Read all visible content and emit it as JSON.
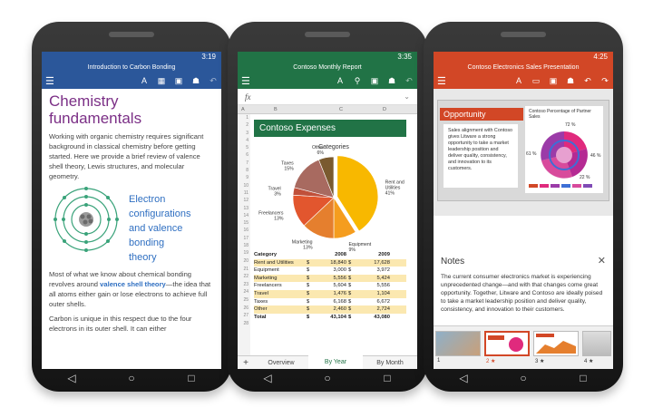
{
  "word": {
    "time": "3:19",
    "title": "Introduction to Carbon Bonding",
    "heading_line1": "Chemistry",
    "heading_line2": "fundamentals",
    "para1": "Working with organic chemistry requires significant background in classical chemistry before getting started. Here we provide a brief review of valence shell theory, Lewis structures, and molecular geometry.",
    "side_l1": "Electron",
    "side_l2": "configurations",
    "side_l3": "and valence",
    "side_l4": "bonding",
    "side_l5": "theory",
    "para2_a": "Most of what we know about chemical bonding revolves around ",
    "para2_link": "valence shell theory",
    "para2_b": "—the idea that all atoms either gain or lose electrons to achieve full outer shells.",
    "para3": "Carbon is unique in this respect due to the four electrons in its outer shell. It can either"
  },
  "excel": {
    "time": "3:35",
    "title": "Contoso Monthly Report",
    "fx": "fx",
    "col_a": "A",
    "col_b": "B",
    "col_c": "C",
    "col_d": "D",
    "banner": "Contoso Expenses",
    "chart_data": {
      "type": "pie",
      "title": "Categories",
      "slices": [
        {
          "label": "Rent and Utilities",
          "pct": "41%",
          "value": 41,
          "color": "#f8b800"
        },
        {
          "label": "Equipment",
          "pct": "9%",
          "value": 9,
          "color": "#f59d1e"
        },
        {
          "label": "Marketing",
          "pct": "13%",
          "value": 13,
          "color": "#e57f2e"
        },
        {
          "label": "Freelancers",
          "pct": "13%",
          "value": 13,
          "color": "#e2562e"
        },
        {
          "label": "Travel",
          "pct": "3%",
          "value": 3,
          "color": "#c0503a"
        },
        {
          "label": "Taxes",
          "pct": "15%",
          "value": 15,
          "color": "#a86a60"
        },
        {
          "label": "Other",
          "pct": "6%",
          "value": 6,
          "color": "#7a5a2f"
        }
      ]
    },
    "table_header": {
      "c1": "Category",
      "c2": "2008",
      "c3": "2009"
    },
    "rows": [
      {
        "n": "20",
        "cat": "Rent and Utilities",
        "v1": "18,840",
        "v2": "17,628"
      },
      {
        "n": "21",
        "cat": "Equipment",
        "v1": "3,000",
        "v2": "3,972"
      },
      {
        "n": "22",
        "cat": "Marketing",
        "v1": "5,556",
        "v2": "5,424"
      },
      {
        "n": "23",
        "cat": "Freelancers",
        "v1": "5,604",
        "v2": "5,556"
      },
      {
        "n": "24",
        "cat": "Travel",
        "v1": "1,476",
        "v2": "1,104"
      },
      {
        "n": "25",
        "cat": "Taxes",
        "v1": "6,168",
        "v2": "6,672"
      },
      {
        "n": "26",
        "cat": "Other",
        "v1": "2,460",
        "v2": "2,724"
      },
      {
        "n": "27",
        "cat": "Total",
        "v1": "43,104",
        "v2": "43,080"
      }
    ],
    "currency": "$",
    "tab_add": "+",
    "tab1": "Overview",
    "tab2": "By Year",
    "tab3": "By Month"
  },
  "ppt": {
    "time": "4:25",
    "title": "Contoso Electronics Sales Presentation",
    "opportunity": "Opportunity",
    "card_text": "Sales alignment with Contoso gives Litware a strong opportunity to take a market leadership position and deliver quality, consistency, and innovation to its customers.",
    "pie_title": "Contoso Percentage of Partner Sales",
    "pie_l1": "72 %",
    "pie_l2": "61 %",
    "pie_l3": "46 %",
    "pie_l4": "22 %",
    "notes_title": "Notes",
    "notes_text": "The current consumer electronics market is experiencing unprecedented change—and with that changes come great opportunity. Together, Litware and Contoso are ideally poised to take a market leadership position and deliver quality, consistency, and innovation to their customers.",
    "thumb1": "1",
    "thumb2": "2 ★",
    "thumb3": "3 ★",
    "thumb4": "4 ★"
  },
  "nav": {
    "back": "◁",
    "home": "○",
    "recent": "□"
  },
  "colors": {
    "word": "#2b579a",
    "excel": "#217346",
    "ppt": "#d24726"
  }
}
